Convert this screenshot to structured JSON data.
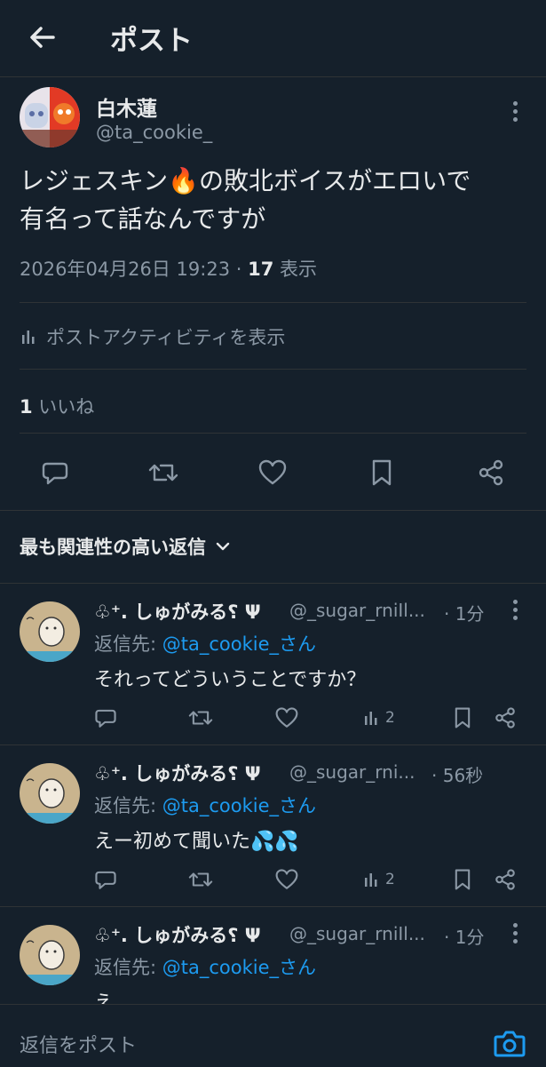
{
  "header": {
    "title": "ポスト",
    "back_icon": "arrow-left-icon"
  },
  "post": {
    "author_name": "白木蓮",
    "author_handle": "@ta_cookie_",
    "text_line1": "レジェスキン🔥の敗北ボイスがエロいで",
    "text_line2": "有名って話なんですが",
    "timestamp": "2026年04月26日 19:23",
    "sep": " · ",
    "views_count": "17",
    "views_label": " 表示",
    "activity_label": "ポストアクティビティを表示",
    "likes_count": "1",
    "likes_label": " いいね"
  },
  "sort_label": "最も関連性の高い返信",
  "replies": [
    {
      "name": "♧⁺. しゅがみる⸮ Ψ",
      "handle": "@_sugar_rniIl...",
      "time": "· 1分",
      "reply_to_prefix": "返信先: ",
      "reply_to_mention": "@ta_cookie_さん",
      "text": "それってどういうことですか？",
      "views": "2"
    },
    {
      "name": "♧⁺. しゅがみる⸮ Ψ",
      "handle": "@_sugar_rni...",
      "time": "· 56秒",
      "reply_to_prefix": "返信先: ",
      "reply_to_mention": "@ta_cookie_さん",
      "text": "えー初めて聞いた💦💦",
      "views": "2"
    },
    {
      "name": "♧⁺. しゅがみる⸮ Ψ",
      "handle": "@_sugar_rniIl...",
      "time": "· 1分",
      "reply_to_prefix": "返信先: ",
      "reply_to_mention": "@ta_cookie_さん",
      "text": "え",
      "views": ""
    }
  ],
  "composer": {
    "placeholder": "返信をポスト"
  },
  "colors": {
    "background": "#15202b",
    "text": "#e7e9ea",
    "muted": "#8b98a5",
    "accent": "#1d9bf0",
    "divider": "#2f3336"
  }
}
